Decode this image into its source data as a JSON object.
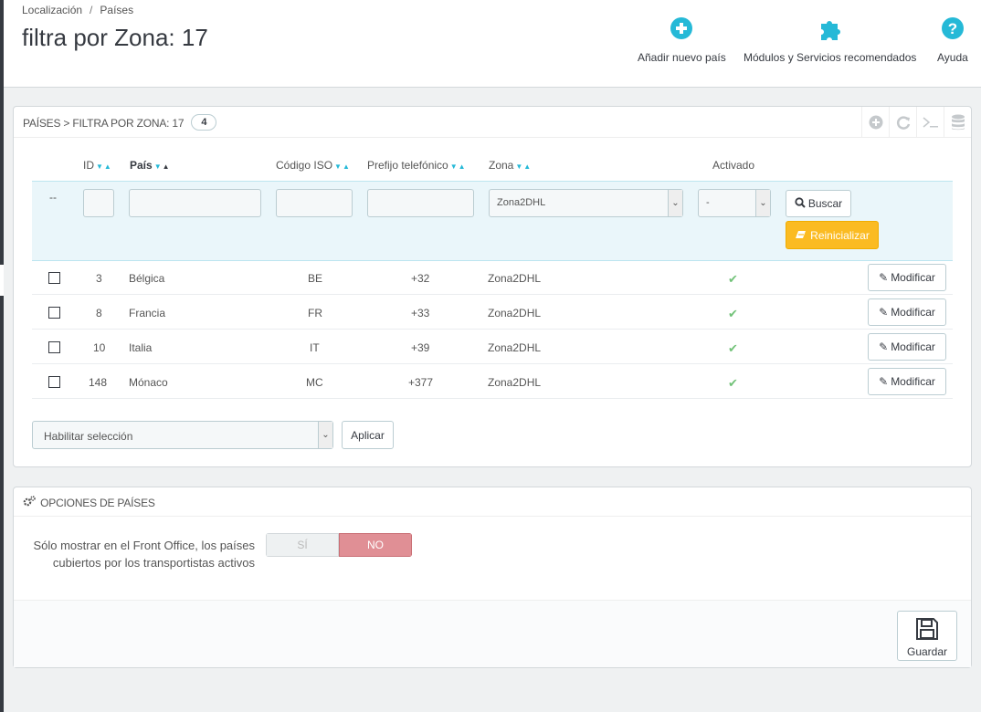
{
  "breadcrumb": {
    "first": "Localización",
    "separator": "/",
    "second": "Países"
  },
  "page_title": "filtra por Zona: 17",
  "toolbar": {
    "add_label": "Añadir nuevo país",
    "modules_label": "Módulos y Servicios recomendados",
    "help_label": "Ayuda"
  },
  "list": {
    "title": "PAÍSES > FILTRA POR ZONA: 17",
    "count": "4",
    "columns": {
      "id": "ID",
      "country": "País",
      "iso": "Código ISO",
      "prefix": "Prefijo telefónico",
      "zone": "Zona",
      "active": "Activado"
    },
    "filter": {
      "dash": "--",
      "zone_value": "Zona2DHL",
      "active_value": "-",
      "search_label": "Buscar",
      "reset_label": "Reinicializar"
    },
    "rows": [
      {
        "id": "3",
        "country": "Bélgica",
        "iso": "BE",
        "prefix": "+32",
        "zone": "Zona2DHL",
        "edit": "Modificar"
      },
      {
        "id": "8",
        "country": "Francia",
        "iso": "FR",
        "prefix": "+33",
        "zone": "Zona2DHL",
        "edit": "Modificar"
      },
      {
        "id": "10",
        "country": "Italia",
        "iso": "IT",
        "prefix": "+39",
        "zone": "Zona2DHL",
        "edit": "Modificar"
      },
      {
        "id": "148",
        "country": "Mónaco",
        "iso": "MC",
        "prefix": "+377",
        "zone": "Zona2DHL",
        "edit": "Modificar"
      }
    ],
    "bulk": {
      "select_value": "Habilitar selección",
      "apply_label": "Aplicar"
    }
  },
  "options": {
    "title": "OPCIONES DE PAÍSES",
    "label": "Sólo mostrar en el Front Office, los países cubiertos por los transportistas activos",
    "yes": "SÍ",
    "no": "NO",
    "save_label": "Guardar"
  },
  "colors": {
    "accent": "#25b9d7",
    "warning": "#fbbb22",
    "success": "#72c279",
    "danger_toggle": "#e08f95"
  }
}
